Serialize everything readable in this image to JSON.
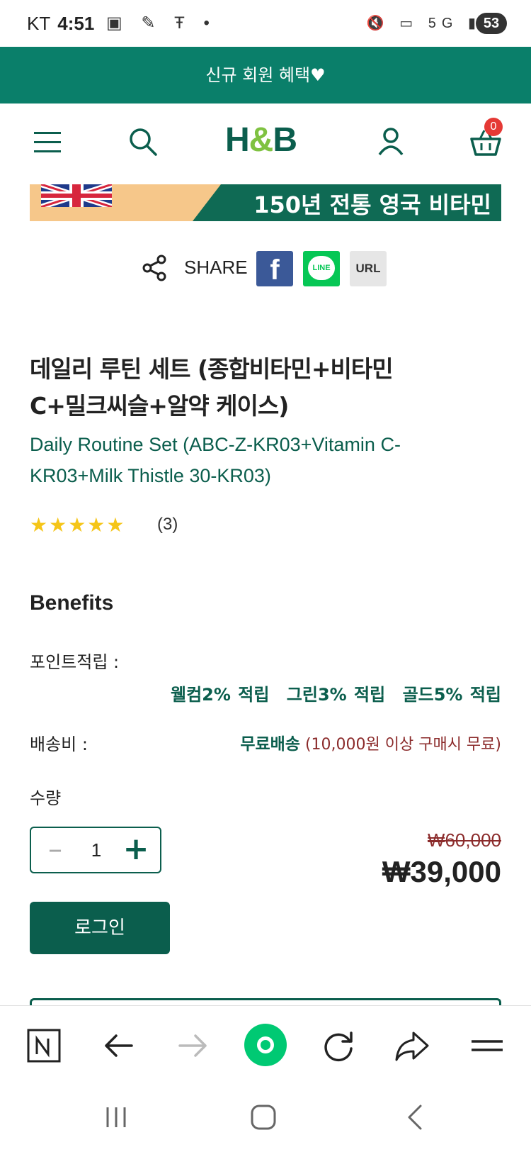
{
  "status_bar": {
    "carrier": "KT",
    "time": "4:51",
    "battery": "53"
  },
  "promo": {
    "text": "신규 회원 혜택♥"
  },
  "header": {
    "logo": "H&B",
    "cart_count": "0"
  },
  "banner": {
    "text": "150년 전통 영국 비타민"
  },
  "share": {
    "label": "SHARE",
    "facebook": "f",
    "line": "LINE",
    "url": "URL"
  },
  "product": {
    "title_line1": "데일리 루틴 세트 (종합비타민+비타민",
    "title_line2": "C+밀크씨슬+알약 케이스)",
    "subtitle_line1": "Daily Routine Set (ABC-Z-KR03+Vitamin C-",
    "subtitle_line2": "KR03+Milk Thistle 30-KR03)",
    "rating": 5,
    "stars": "★★★★★",
    "review_count": "(3)"
  },
  "benefits": {
    "heading": "Benefits",
    "points_label": "포인트적립 :",
    "points": [
      "웰컴2% 적립",
      "그린3% 적립",
      "골드5% 적립"
    ],
    "shipping_label": "배송비 :",
    "shipping_free": "무료배송",
    "shipping_condition": "(10,000원 이상 구매시 무료)"
  },
  "purchase": {
    "qty_label": "수량",
    "quantity": "1",
    "original_price": "₩60,000",
    "price": "₩39,000",
    "login_button": "로그인"
  },
  "colors": {
    "brand_green": "#0b5e4d",
    "promo_green": "#0a7f6a",
    "accent_red": "#8b2b2b",
    "star": "#f5c518"
  }
}
